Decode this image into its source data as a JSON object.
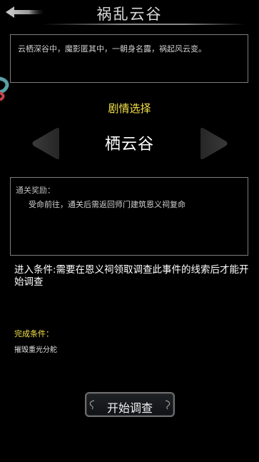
{
  "header": {
    "title": "祸乱云谷"
  },
  "story": {
    "text": "云栖深谷中，魔影匿其中，一朝身名露，祸起风云变。"
  },
  "selection": {
    "section_title": "剧情选择",
    "location_name": "栖云谷"
  },
  "reward": {
    "label": "通关奖励：",
    "text": "受命前往，通关后需返回师门建筑恩义祠复命"
  },
  "entry": {
    "text": "进入条件:需要在恩义祠领取调查此事件的线索后才能开始调查"
  },
  "completion": {
    "label": "完成条件：",
    "text": "摧毁重光分舵"
  },
  "action": {
    "start_label": "开始调查"
  },
  "colors": {
    "accent_yellow": "#f5e24a",
    "border_gray": "#7d7d7d",
    "background": "#000000"
  },
  "icons": {
    "back": "back-arrow-icon",
    "prev": "triangle-left-icon",
    "next": "triangle-right-icon"
  }
}
